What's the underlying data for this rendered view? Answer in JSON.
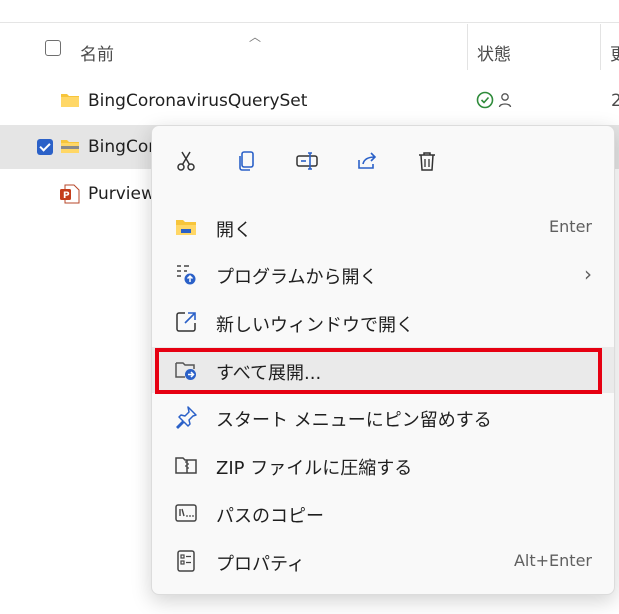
{
  "header": {
    "name_label": "名前",
    "status_label": "状態",
    "extra_col_label": "更"
  },
  "files": [
    {
      "name": "BingCoronavirusQuerySet",
      "extra": "2"
    },
    {
      "name": "BingCor",
      "extra": ""
    },
    {
      "name": "Purview",
      "extra": ""
    }
  ],
  "context_menu": {
    "quick_actions": [
      {
        "icon": "cut-icon"
      },
      {
        "icon": "copy-icon"
      },
      {
        "icon": "rename-icon"
      },
      {
        "icon": "share-icon"
      },
      {
        "icon": "delete-icon"
      }
    ],
    "items": [
      {
        "label": "開く",
        "accel": "Enter",
        "icon": "folder-open-icon"
      },
      {
        "label": "プログラムから開く",
        "accel": "",
        "icon": "open-with-icon",
        "submenu": true
      },
      {
        "label": "新しいウィンドウで開く",
        "accel": "",
        "icon": "new-window-icon"
      },
      {
        "label": "すべて展開...",
        "accel": "",
        "icon": "extract-all-icon"
      },
      {
        "label": "スタート メニューにピン留めする",
        "accel": "",
        "icon": "pin-icon"
      },
      {
        "label": "ZIP ファイルに圧縮する",
        "accel": "",
        "icon": "zip-icon"
      },
      {
        "label": "パスのコピー",
        "accel": "",
        "icon": "copy-path-icon"
      },
      {
        "label": "プロパティ",
        "accel": "Alt+Enter",
        "icon": "properties-icon"
      }
    ],
    "submenu_chevron": "›"
  },
  "colors": {
    "accent": "#2b61c8",
    "highlight": "#e60012",
    "folder": "#f7c53b",
    "status_ok": "#2e8b3a"
  }
}
